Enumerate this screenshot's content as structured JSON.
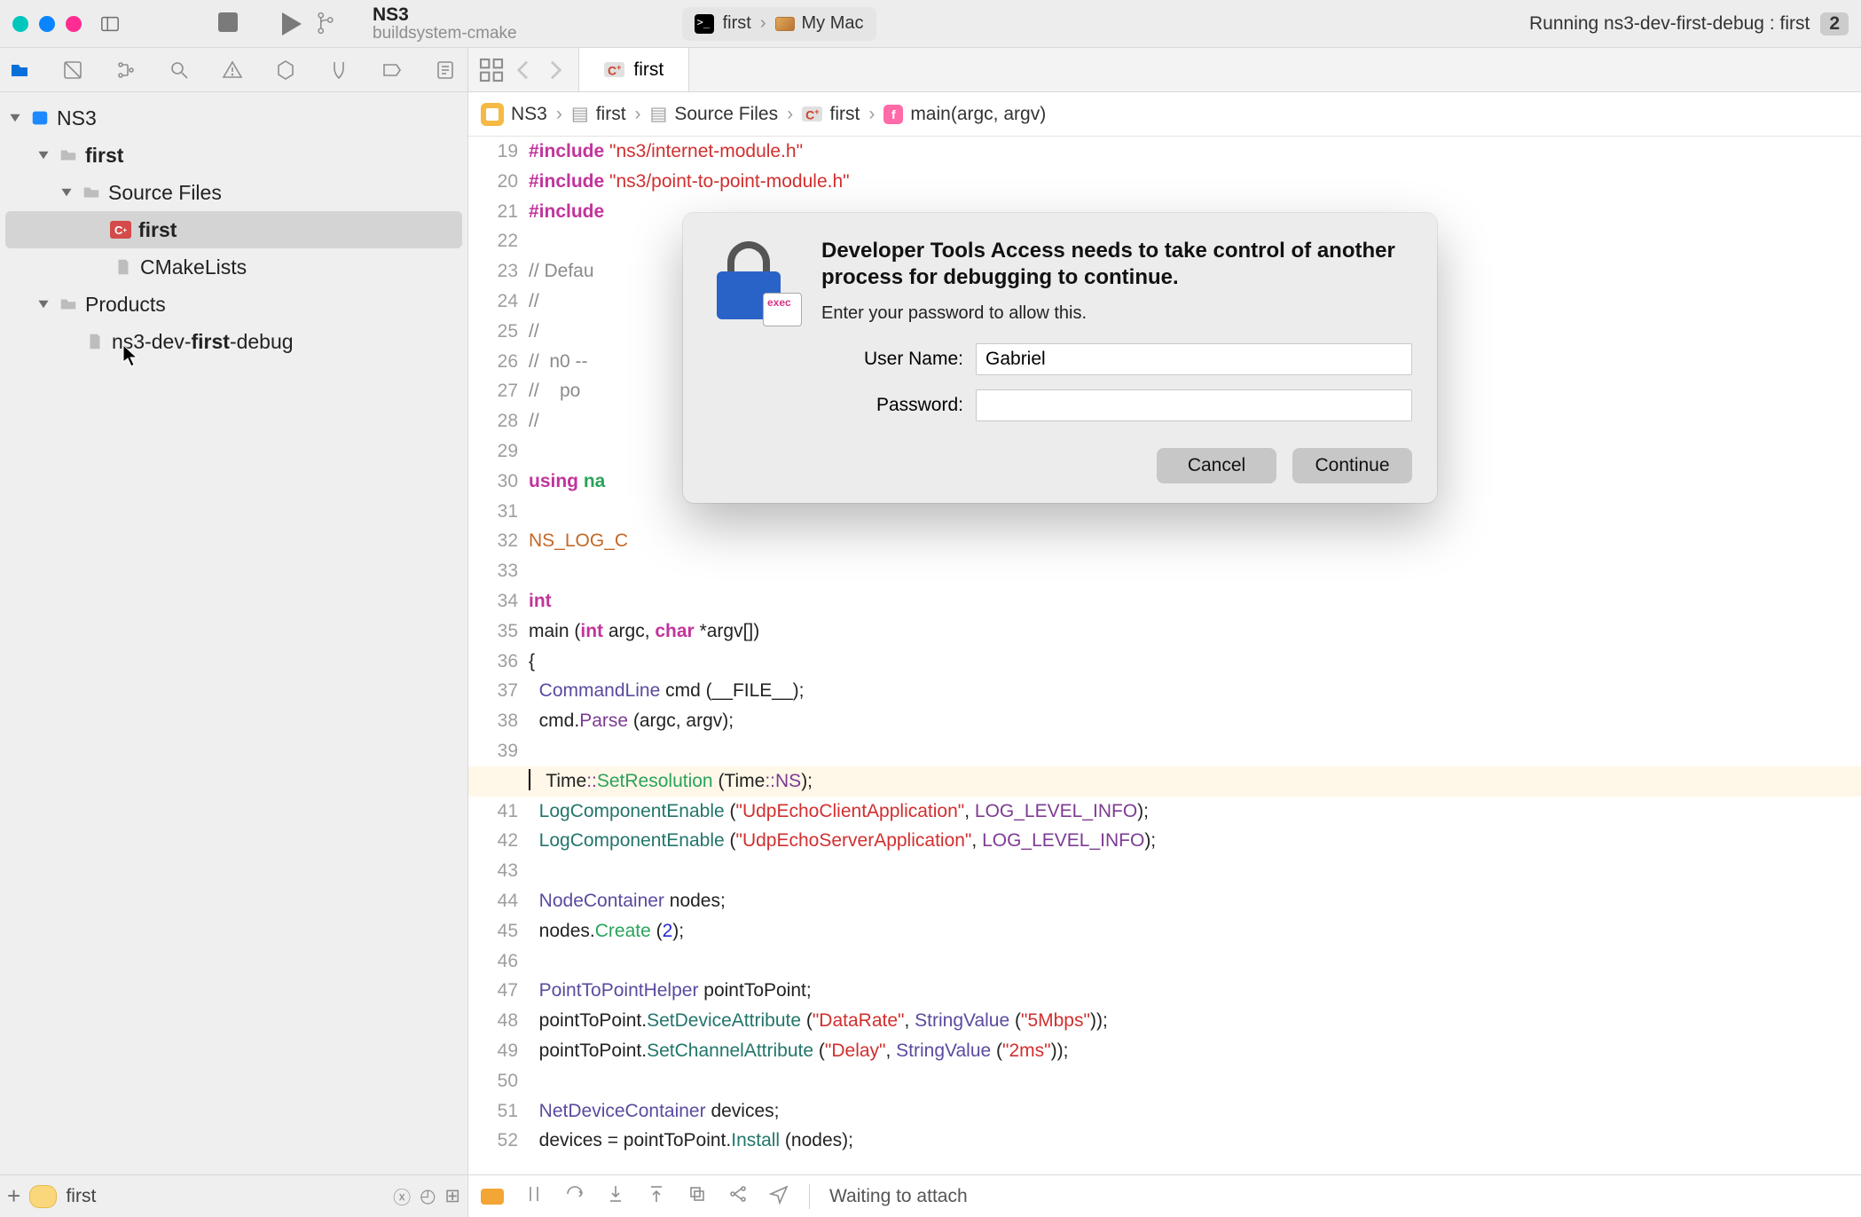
{
  "window": {
    "project_name": "NS3",
    "branch_name": "buildsystem-cmake"
  },
  "scheme": {
    "target": "first",
    "device": "My Mac"
  },
  "activity": {
    "status": "Running ns3-dev-first-debug : first",
    "count": "2"
  },
  "navigator": {
    "root": "NS3",
    "items": [
      {
        "label": "first",
        "kind": "folder"
      },
      {
        "label": "Source Files",
        "kind": "folder"
      },
      {
        "label": "first",
        "kind": "cpp",
        "selected": true
      },
      {
        "label": "CMakeLists",
        "kind": "doc"
      },
      {
        "label": "Products",
        "kind": "folder"
      },
      {
        "label_pre": "ns3-dev-",
        "label_bold": "first",
        "label_post": "-debug",
        "kind": "doc"
      }
    ],
    "filter": {
      "chip": "",
      "text": "first"
    }
  },
  "tabs": {
    "open": "first"
  },
  "jump_bar": {
    "p0": "NS3",
    "p1": "first",
    "p2": "Source Files",
    "p3": "first",
    "p4": "main(argc, argv)"
  },
  "code": {
    "first_line_no": 19,
    "breakpoint_line": 40,
    "lines": [
      {
        "seg": [
          {
            "c": "kw-pp",
            "t": "#include "
          },
          {
            "c": "str",
            "t": "\"ns3/internet-module.h\""
          }
        ]
      },
      {
        "seg": [
          {
            "c": "kw-pp",
            "t": "#include "
          },
          {
            "c": "str",
            "t": "\"ns3/point-to-point-module.h\""
          }
        ]
      },
      {
        "seg": [
          {
            "c": "kw-pp",
            "t": "#include"
          }
        ]
      },
      {
        "seg": [
          {
            "c": "",
            "t": ""
          }
        ]
      },
      {
        "seg": [
          {
            "c": "cmt",
            "t": "// Defau"
          }
        ]
      },
      {
        "seg": [
          {
            "c": "cmt",
            "t": "//"
          }
        ]
      },
      {
        "seg": [
          {
            "c": "cmt",
            "t": "//"
          }
        ]
      },
      {
        "seg": [
          {
            "c": "cmt",
            "t": "//  n0 --"
          }
        ]
      },
      {
        "seg": [
          {
            "c": "cmt",
            "t": "//    po"
          }
        ]
      },
      {
        "seg": [
          {
            "c": "cmt",
            "t": "//"
          }
        ]
      },
      {
        "seg": [
          {
            "c": "",
            "t": ""
          }
        ]
      },
      {
        "seg": [
          {
            "c": "kw-pp",
            "t": "using "
          },
          {
            "c": "kw-ns",
            "t": "na"
          }
        ]
      },
      {
        "seg": [
          {
            "c": "",
            "t": ""
          }
        ]
      },
      {
        "seg": [
          {
            "c": "macro",
            "t": "NS_LOG_C"
          }
        ]
      },
      {
        "seg": [
          {
            "c": "",
            "t": ""
          }
        ]
      },
      {
        "seg": [
          {
            "c": "kw-type",
            "t": "int"
          }
        ]
      },
      {
        "seg": [
          {
            "c": "",
            "t": "main ("
          },
          {
            "c": "kw-type",
            "t": "int"
          },
          {
            "c": "",
            "t": " argc, "
          },
          {
            "c": "kw-type",
            "t": "char"
          },
          {
            "c": "",
            "t": " *argv[])"
          }
        ]
      },
      {
        "seg": [
          {
            "c": "",
            "t": "{"
          }
        ]
      },
      {
        "seg": [
          {
            "c": "",
            "t": "  "
          },
          {
            "c": "type2",
            "t": "CommandLine"
          },
          {
            "c": "",
            "t": " cmd (__FILE__);"
          }
        ]
      },
      {
        "seg": [
          {
            "c": "",
            "t": "  cmd."
          },
          {
            "c": "fn2",
            "t": "Parse"
          },
          {
            "c": "",
            "t": " (argc, argv);"
          }
        ]
      },
      {
        "seg": [
          {
            "c": "",
            "t": ""
          }
        ]
      },
      {
        "hl": true,
        "seg": [
          {
            "c": "",
            "t": "  Time"
          },
          {
            "c": "scope",
            "t": "::"
          },
          {
            "c": "fn3",
            "t": "SetResolution"
          },
          {
            "c": "",
            "t": " (Time"
          },
          {
            "c": "scope",
            "t": "::"
          },
          {
            "c": "enum",
            "t": "NS"
          },
          {
            "c": "",
            "t": ");"
          }
        ]
      },
      {
        "seg": [
          {
            "c": "",
            "t": "  "
          },
          {
            "c": "fn",
            "t": "LogComponentEnable"
          },
          {
            "c": "",
            "t": " ("
          },
          {
            "c": "str",
            "t": "\"UdpEchoClientApplication\""
          },
          {
            "c": "",
            "t": ", "
          },
          {
            "c": "enum",
            "t": "LOG_LEVEL_INFO"
          },
          {
            "c": "",
            "t": ");"
          }
        ]
      },
      {
        "seg": [
          {
            "c": "",
            "t": "  "
          },
          {
            "c": "fn",
            "t": "LogComponentEnable"
          },
          {
            "c": "",
            "t": " ("
          },
          {
            "c": "str",
            "t": "\"UdpEchoServerApplication\""
          },
          {
            "c": "",
            "t": ", "
          },
          {
            "c": "enum",
            "t": "LOG_LEVEL_INFO"
          },
          {
            "c": "",
            "t": ");"
          }
        ]
      },
      {
        "seg": [
          {
            "c": "",
            "t": ""
          }
        ]
      },
      {
        "seg": [
          {
            "c": "",
            "t": "  "
          },
          {
            "c": "type2",
            "t": "NodeContainer"
          },
          {
            "c": "",
            "t": " nodes;"
          }
        ]
      },
      {
        "seg": [
          {
            "c": "",
            "t": "  nodes."
          },
          {
            "c": "fn3",
            "t": "Create"
          },
          {
            "c": "",
            "t": " ("
          },
          {
            "c": "num",
            "t": "2"
          },
          {
            "c": "",
            "t": ");"
          }
        ]
      },
      {
        "seg": [
          {
            "c": "",
            "t": ""
          }
        ]
      },
      {
        "seg": [
          {
            "c": "",
            "t": "  "
          },
          {
            "c": "type2",
            "t": "PointToPointHelper"
          },
          {
            "c": "",
            "t": " pointToPoint;"
          }
        ]
      },
      {
        "seg": [
          {
            "c": "",
            "t": "  pointToPoint."
          },
          {
            "c": "fn",
            "t": "SetDeviceAttribute"
          },
          {
            "c": "",
            "t": " ("
          },
          {
            "c": "str",
            "t": "\"DataRate\""
          },
          {
            "c": "",
            "t": ", "
          },
          {
            "c": "type2",
            "t": "StringValue"
          },
          {
            "c": "",
            "t": " ("
          },
          {
            "c": "str",
            "t": "\"5Mbps\""
          },
          {
            "c": "",
            "t": "));"
          }
        ]
      },
      {
        "seg": [
          {
            "c": "",
            "t": "  pointToPoint."
          },
          {
            "c": "fn",
            "t": "SetChannelAttribute"
          },
          {
            "c": "",
            "t": " ("
          },
          {
            "c": "str",
            "t": "\"Delay\""
          },
          {
            "c": "",
            "t": ", "
          },
          {
            "c": "type2",
            "t": "StringValue"
          },
          {
            "c": "",
            "t": " ("
          },
          {
            "c": "str",
            "t": "\"2ms\""
          },
          {
            "c": "",
            "t": "));"
          }
        ]
      },
      {
        "seg": [
          {
            "c": "",
            "t": ""
          }
        ]
      },
      {
        "seg": [
          {
            "c": "",
            "t": "  "
          },
          {
            "c": "type2",
            "t": "NetDeviceContainer"
          },
          {
            "c": "",
            "t": " devices;"
          }
        ]
      },
      {
        "seg": [
          {
            "c": "",
            "t": "  devices = pointToPoint."
          },
          {
            "c": "fn",
            "t": "Install"
          },
          {
            "c": "",
            "t": " (nodes);"
          }
        ]
      }
    ]
  },
  "debug_bar": {
    "status": "Waiting to attach"
  },
  "dialog": {
    "title": "Developer Tools Access needs to take control of another process for debugging to continue.",
    "subtitle": "Enter your password to allow this.",
    "username_label": "User Name:",
    "password_label": "Password:",
    "username_value": "Gabriel",
    "password_value": "",
    "cancel": "Cancel",
    "continue": "Continue"
  }
}
